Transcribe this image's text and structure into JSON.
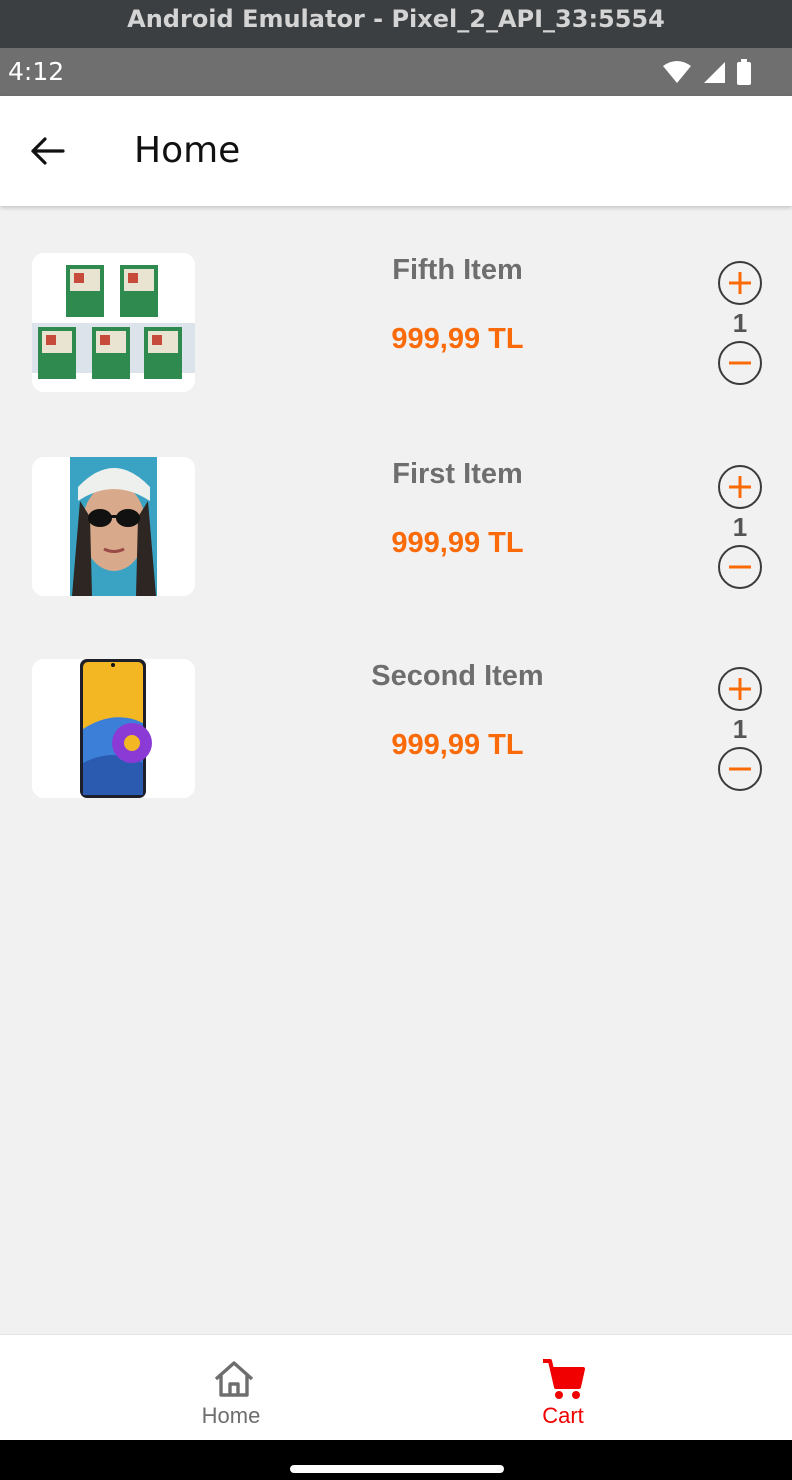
{
  "emulator": {
    "title": "Android Emulator - Pixel_2_API_33:5554"
  },
  "status_bar": {
    "time": "4:12",
    "icons": [
      "wifi-icon",
      "signal-icon",
      "battery-icon"
    ]
  },
  "appbar": {
    "title": "Home",
    "back_icon": "arrow-left-icon"
  },
  "colors": {
    "accent": "#fb6a08",
    "cart_active": "#f00000",
    "background": "#f1f1f1"
  },
  "items": [
    {
      "name": "Fifth Item",
      "price": "999,99 TL",
      "quantity": "1",
      "image": "seed-packets-image"
    },
    {
      "name": "First Item",
      "price": "999,99 TL",
      "quantity": "1",
      "image": "woman-sunglasses-image"
    },
    {
      "name": "Second Item",
      "price": "999,99 TL",
      "quantity": "1",
      "image": "smartphone-image"
    }
  ],
  "bottom_nav": {
    "home": {
      "label": "Home",
      "icon": "home-icon"
    },
    "cart": {
      "label": "Cart",
      "icon": "cart-icon",
      "active": true
    }
  }
}
